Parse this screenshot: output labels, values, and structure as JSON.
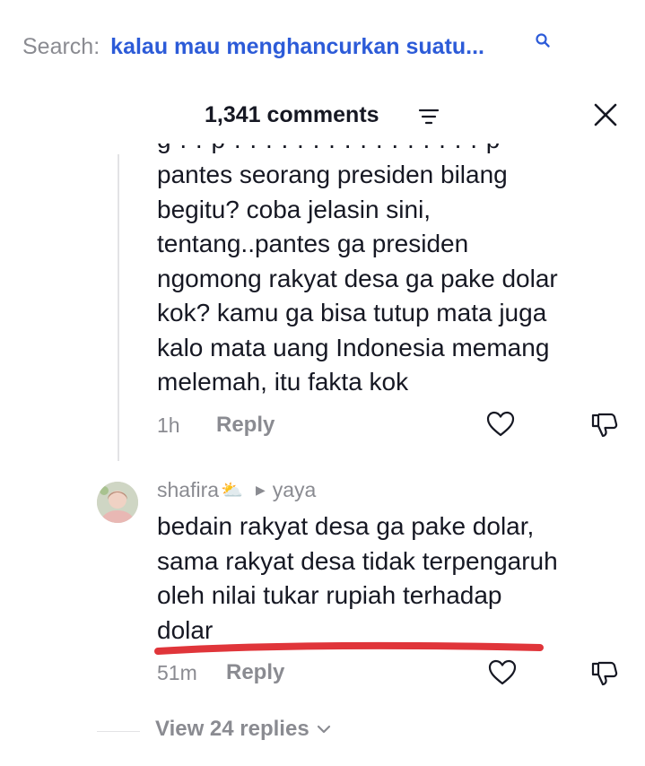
{
  "search": {
    "prefix": "Search:",
    "query": "kalau mau menghancurkan suatu..."
  },
  "header": {
    "comment_count": "1,341 comments"
  },
  "comments": [
    {
      "text": "pantes seorang presiden bilang\nbegitu? coba jelasin sini,\ntentang..pantes ga presiden\nngomong rakyat desa ga pake dolar\nkok? kamu ga bisa tutup mata juga\nkalo mata uang Indonesia memang\nmelemah, itu fakta kok",
      "time": "1h",
      "reply_label": "Reply"
    },
    {
      "username": "shafira",
      "username_emoji": "⛅",
      "reply_to": "yaya",
      "text": "bedain rakyat desa ga pake dolar,\nsama rakyat desa tidak terpengaruh\noleh nilai tukar rupiah terhadap\ndolar",
      "time": "51m",
      "reply_label": "Reply",
      "underline_color": "#e0353a"
    }
  ],
  "view_replies": "View 24 replies",
  "colors": {
    "accent": "#2c5bd8",
    "muted": "#8a8b91",
    "text": "#161823"
  }
}
